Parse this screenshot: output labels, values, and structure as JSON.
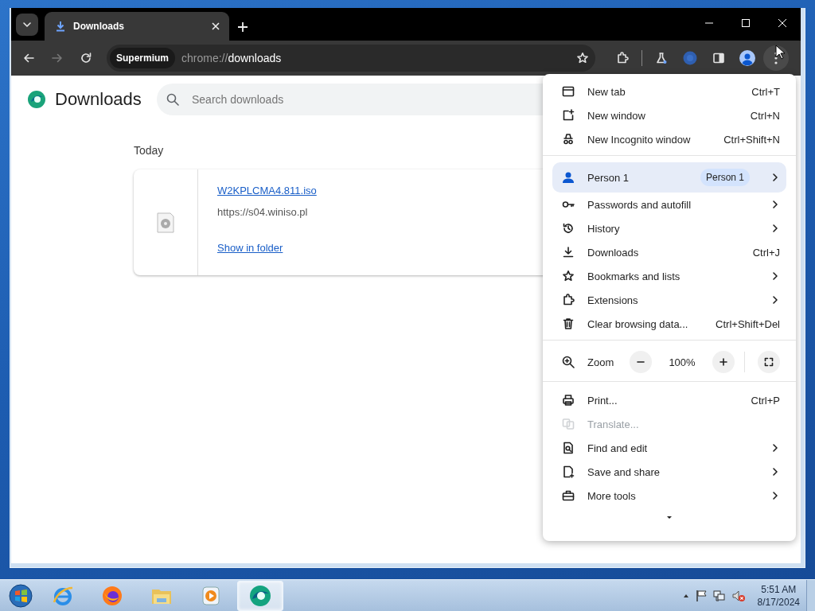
{
  "tab": {
    "title": "Downloads",
    "selected": true
  },
  "nav": [
    {
      "kind": "back",
      "disabled": false
    },
    {
      "kind": "forward",
      "disabled": true
    },
    {
      "kind": "reload",
      "disabled": false
    }
  ],
  "address": {
    "chip": "Supermium",
    "scheme": "chrome://",
    "path": "downloads"
  },
  "page": {
    "title": "Downloads",
    "search": {
      "placeholder": "Search downloads"
    },
    "section": "Today",
    "download": {
      "filename": "W2KPLCMA4.811.iso",
      "url": "https://s04.winiso.pl",
      "action": "Show in folder"
    }
  },
  "menu": {
    "items": [
      {
        "kind": "item",
        "label": "New tab",
        "shortcut": "Ctrl+T",
        "submenu": false,
        "disabled": false
      },
      {
        "kind": "item",
        "label": "New window",
        "shortcut": "Ctrl+N",
        "submenu": false,
        "disabled": false
      },
      {
        "kind": "item",
        "label": "New Incognito window",
        "shortcut": "Ctrl+Shift+N",
        "submenu": false,
        "disabled": false
      },
      {
        "kind": "separator"
      },
      {
        "kind": "profile",
        "label": "Person 1",
        "badge": "Person 1",
        "submenu": true
      },
      {
        "kind": "item",
        "label": "Passwords and autofill",
        "submenu": true,
        "disabled": false
      },
      {
        "kind": "item",
        "label": "History",
        "submenu": true,
        "disabled": false
      },
      {
        "kind": "item",
        "label": "Downloads",
        "shortcut": "Ctrl+J",
        "submenu": false,
        "disabled": false
      },
      {
        "kind": "item",
        "label": "Bookmarks and lists",
        "submenu": true,
        "disabled": false
      },
      {
        "kind": "item",
        "label": "Extensions",
        "submenu": true,
        "disabled": false
      },
      {
        "kind": "item",
        "label": "Clear browsing data...",
        "shortcut": "Ctrl+Shift+Del",
        "submenu": false,
        "disabled": false
      },
      {
        "kind": "separator"
      },
      {
        "kind": "zoom",
        "label": "Zoom",
        "value": "100%"
      },
      {
        "kind": "separator"
      },
      {
        "kind": "item",
        "label": "Print...",
        "shortcut": "Ctrl+P",
        "submenu": false,
        "disabled": false
      },
      {
        "kind": "item",
        "label": "Translate...",
        "submenu": false,
        "disabled": true
      },
      {
        "kind": "item",
        "label": "Find and edit",
        "submenu": true,
        "disabled": false
      },
      {
        "kind": "item",
        "label": "Save and share",
        "submenu": true,
        "disabled": false
      },
      {
        "kind": "item",
        "label": "More tools",
        "submenu": true,
        "disabled": false
      },
      {
        "kind": "more"
      }
    ]
  },
  "taskbar": {
    "apps": [
      {
        "kind": "ie",
        "selected": false
      },
      {
        "kind": "firefox",
        "selected": false
      },
      {
        "kind": "explorer",
        "selected": false
      },
      {
        "kind": "media",
        "selected": false
      },
      {
        "kind": "supermium",
        "selected": true
      }
    ],
    "clock": {
      "time": "5:51 AM",
      "date": "8/17/2024"
    }
  }
}
